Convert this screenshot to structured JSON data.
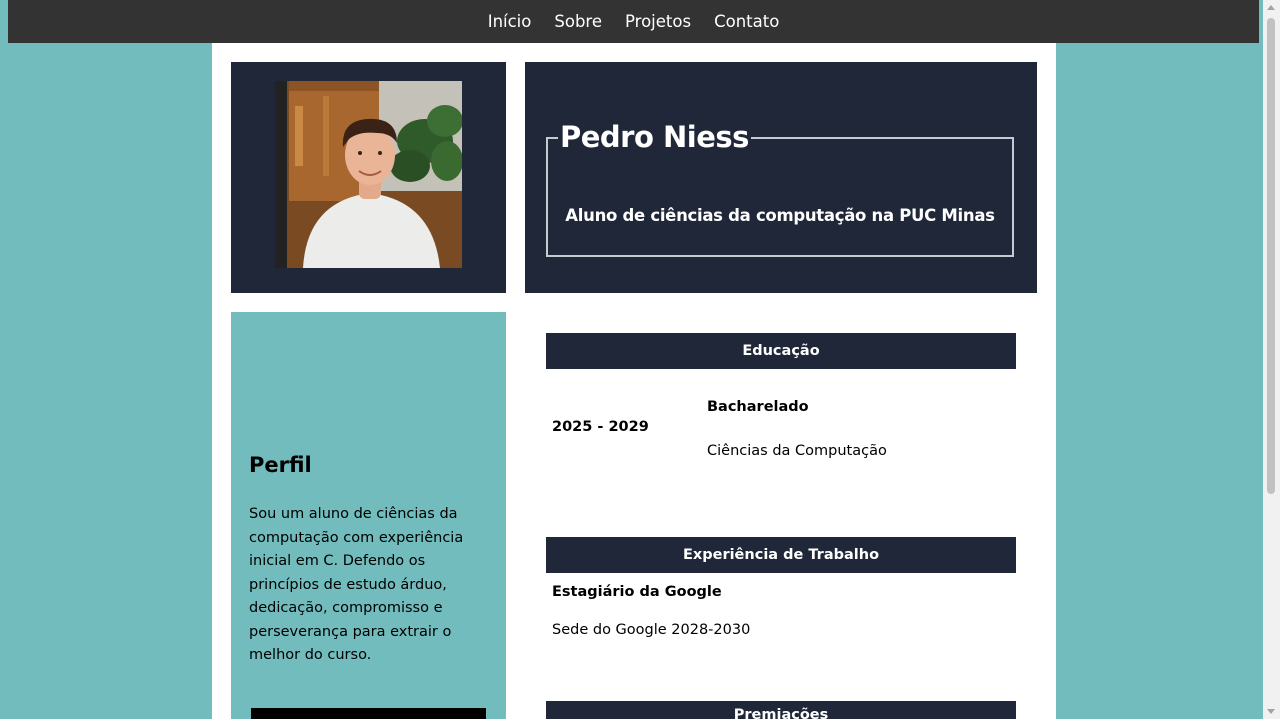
{
  "nav": {
    "items": [
      {
        "label": "Início"
      },
      {
        "label": "Sobre"
      },
      {
        "label": "Projetos"
      },
      {
        "label": "Contato"
      }
    ]
  },
  "header": {
    "name": "Pedro Niess",
    "subtitle": "Aluno de ciências da computação na PUC Minas"
  },
  "profile": {
    "title": "Perfil",
    "text": "Sou um aluno de ciências da computação com experiência inicial em C. Defendo os princípios de estudo árduo, dedicação, compromisso e perseverança para extrair o melhor do curso."
  },
  "education": {
    "heading": "Educação",
    "years": "2025 - 2029",
    "degree": "Bacharelado",
    "course": "Ciências da Computação"
  },
  "work": {
    "heading": "Experiência de Trabalho",
    "role": "Estagiário da Google",
    "detail": "Sede do Google 2028-2030"
  },
  "awards": {
    "heading": "Premiações"
  },
  "colors": {
    "background": "#72bcbd",
    "navbar": "#333333",
    "panel": "#1f2738",
    "page": "#ffffff"
  },
  "photo": {
    "icon": "profile-photo"
  }
}
